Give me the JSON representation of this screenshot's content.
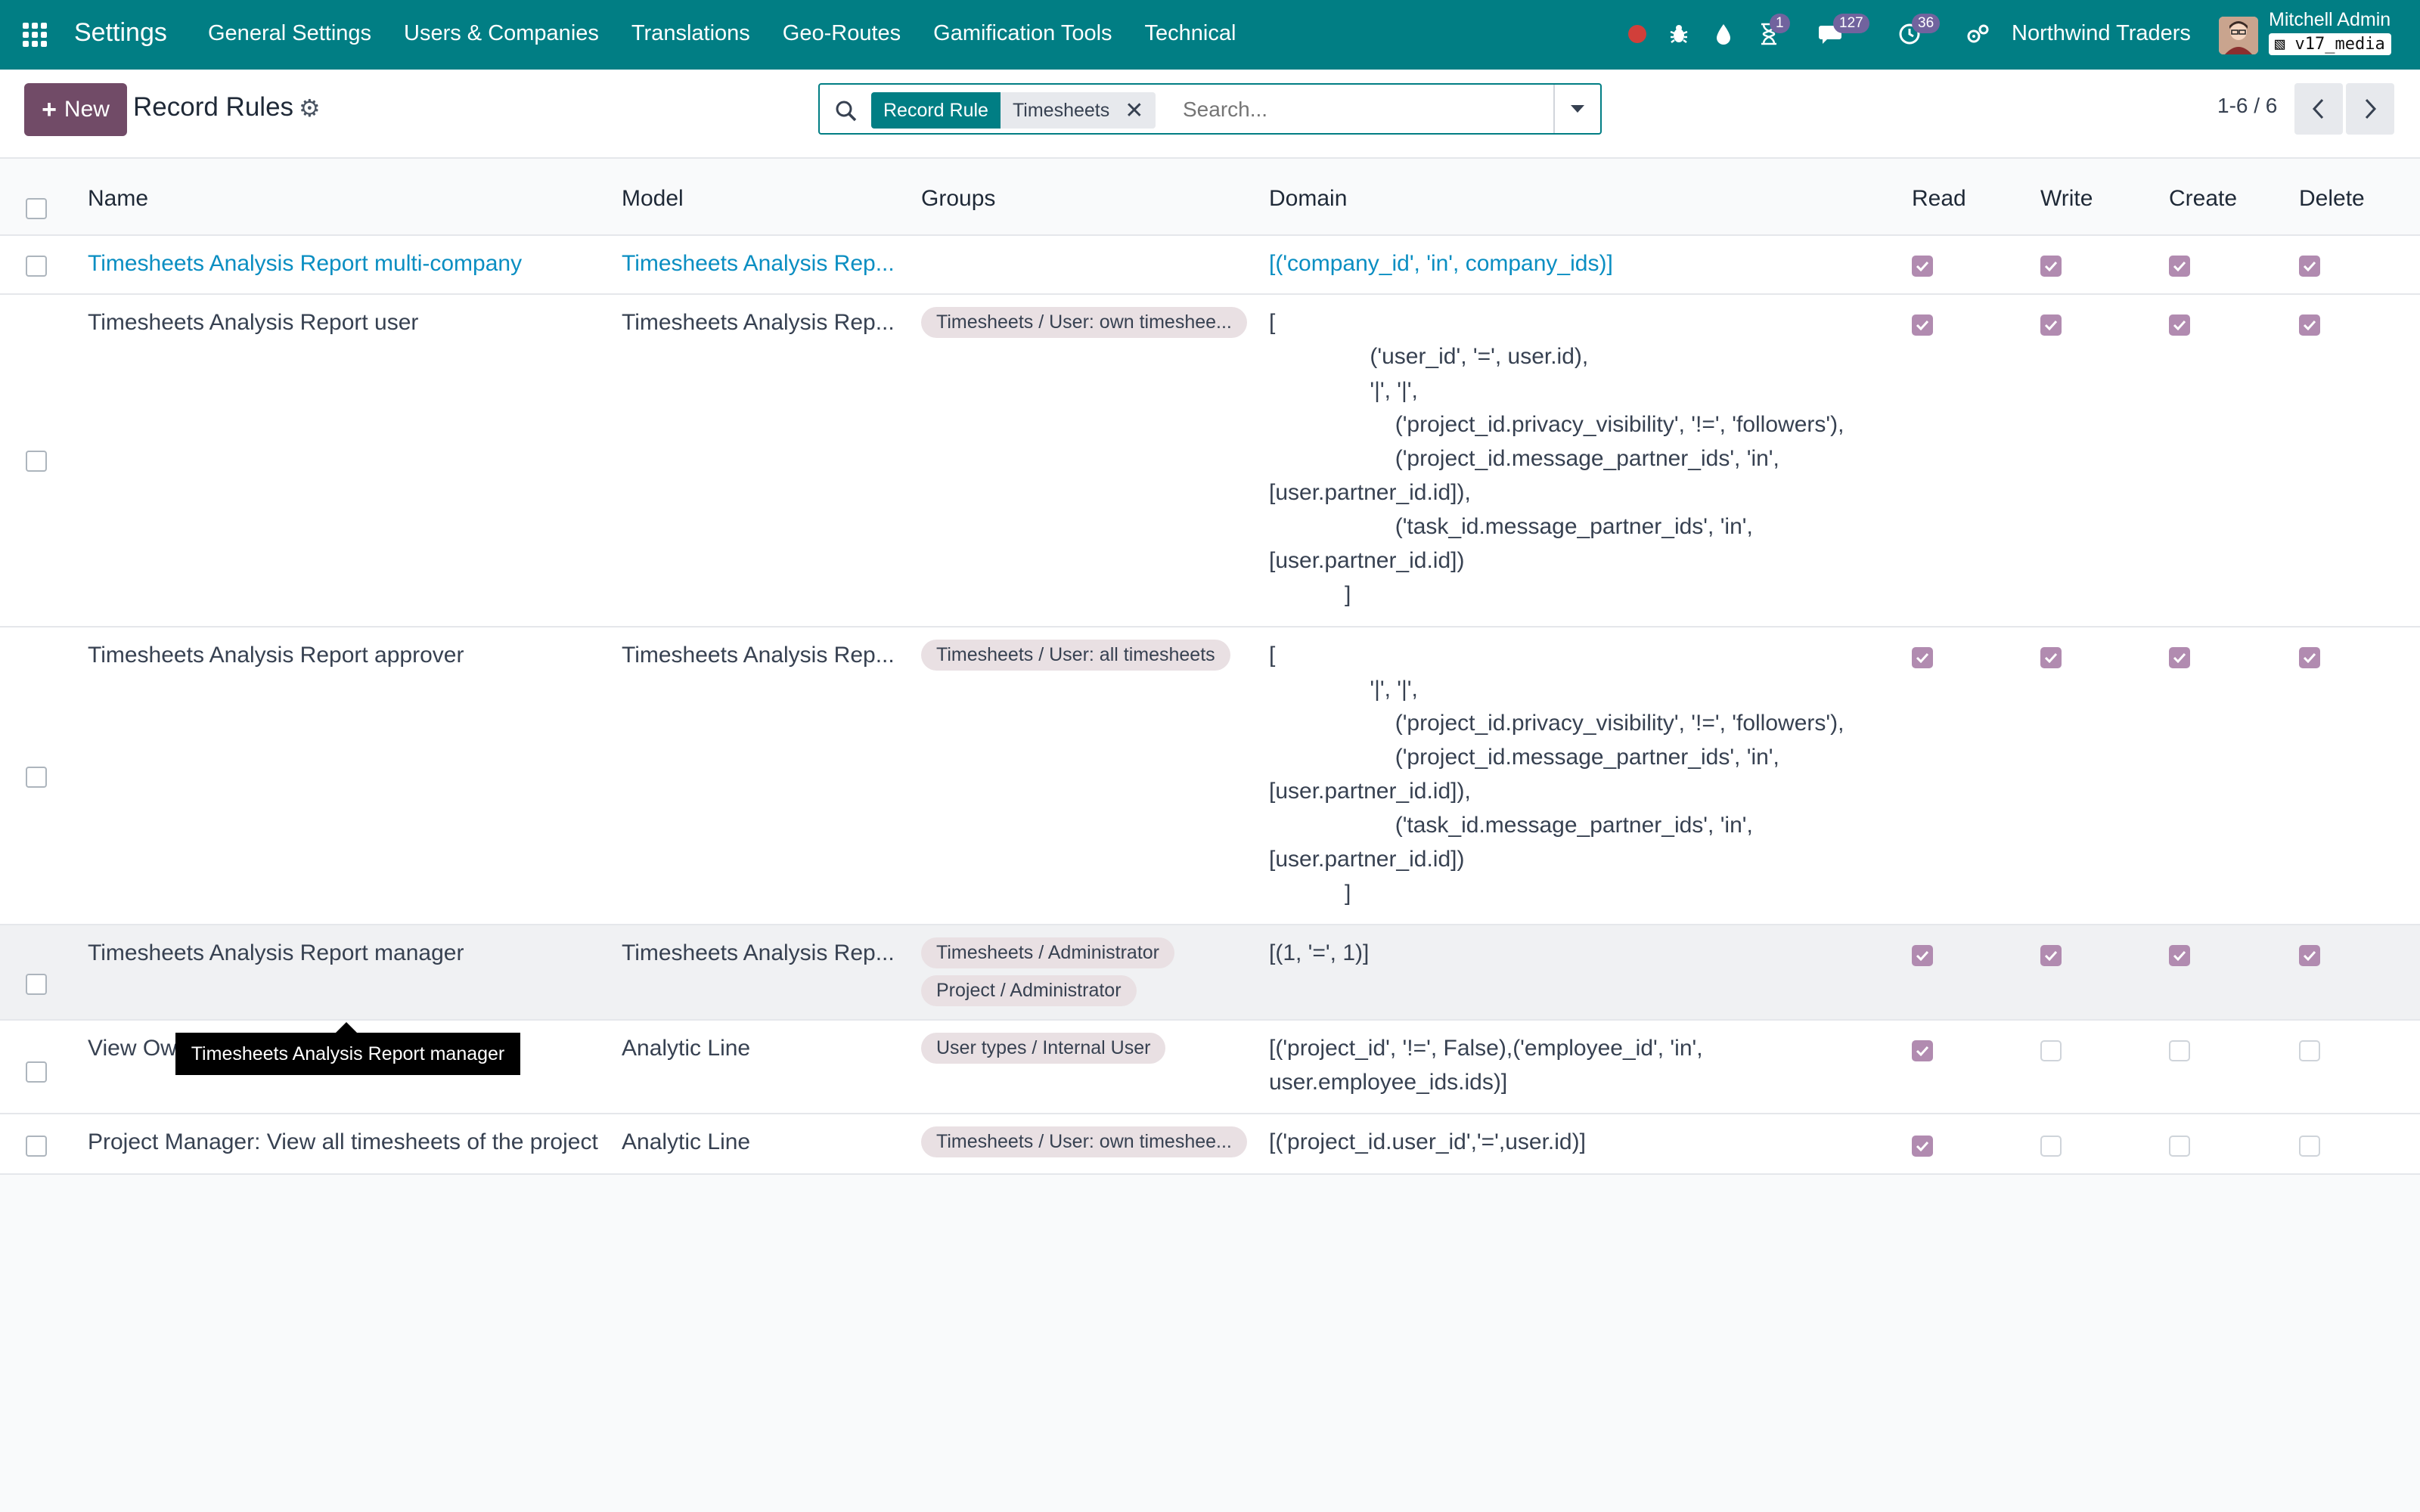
{
  "app": {
    "title": "Settings"
  },
  "menu": [
    "General Settings",
    "Users & Companies",
    "Translations",
    "Geo-Routes",
    "Gamification Tools",
    "Technical"
  ],
  "systray": {
    "activity_badge": "1",
    "messages_badge": "127",
    "timer_badge": "36",
    "company": "Northwind Traders",
    "user_name": "Mitchell Admin",
    "db_name": "v17_media"
  },
  "control": {
    "new_label": "New",
    "title": "Record Rules",
    "facet_label": "Record Rule",
    "facet_value": "Timesheets",
    "search_placeholder": "Search...",
    "pager": "1-6 / 6"
  },
  "columns": {
    "name": "Name",
    "model": "Model",
    "groups": "Groups",
    "domain": "Domain",
    "read": "Read",
    "write": "Write",
    "create": "Create",
    "delete": "Delete"
  },
  "rows": [
    {
      "name": "Timesheets Analysis Report multi-company",
      "model": "Timesheets Analysis Rep...",
      "groups": [],
      "domain": "[('company_id', 'in', company_ids)]",
      "read": true,
      "write": true,
      "create": true,
      "delete": true
    },
    {
      "name": "Timesheets Analysis Report user",
      "model": "Timesheets Analysis Rep...",
      "groups": [
        "Timesheets / User: own timeshee..."
      ],
      "domain": "[\n                ('user_id', '=', user.id),\n                '|', '|',\n                    ('project_id.privacy_visibility', '!=', 'followers'),\n                    ('project_id.message_partner_ids', 'in',\n[user.partner_id.id]),\n                    ('task_id.message_partner_ids', 'in',\n[user.partner_id.id])\n            ]",
      "read": true,
      "write": true,
      "create": true,
      "delete": true
    },
    {
      "name": "Timesheets Analysis Report approver",
      "model": "Timesheets Analysis Rep...",
      "groups": [
        "Timesheets / User: all timesheets"
      ],
      "domain": "[\n                '|', '|',\n                    ('project_id.privacy_visibility', '!=', 'followers'),\n                    ('project_id.message_partner_ids', 'in',\n[user.partner_id.id]),\n                    ('task_id.message_partner_ids', 'in',\n[user.partner_id.id])\n            ]",
      "read": true,
      "write": true,
      "create": true,
      "delete": true
    },
    {
      "name": "Timesheets Analysis Report manager",
      "model": "Timesheets Analysis Rep...",
      "groups": [
        "Timesheets / Administrator",
        "Project / Administrator"
      ],
      "domain": "[(1, '=', 1)]",
      "read": true,
      "write": true,
      "create": true,
      "delete": true
    },
    {
      "name": "View Ow",
      "model": "Analytic Line",
      "groups": [
        "User types / Internal User"
      ],
      "domain": "[('project_id', '!=', False),('employee_id', 'in',\nuser.employee_ids.ids)]",
      "read": true,
      "write": false,
      "create": false,
      "delete": false
    },
    {
      "name": "Project Manager: View all timesheets of the project",
      "model": "Analytic Line",
      "groups": [
        "Timesheets / User: own timeshee..."
      ],
      "domain": "[('project_id.user_id','=',user.id)]",
      "read": true,
      "write": false,
      "create": false,
      "delete": false
    }
  ],
  "tooltip": {
    "text": "Timesheets Analysis Report manager"
  }
}
